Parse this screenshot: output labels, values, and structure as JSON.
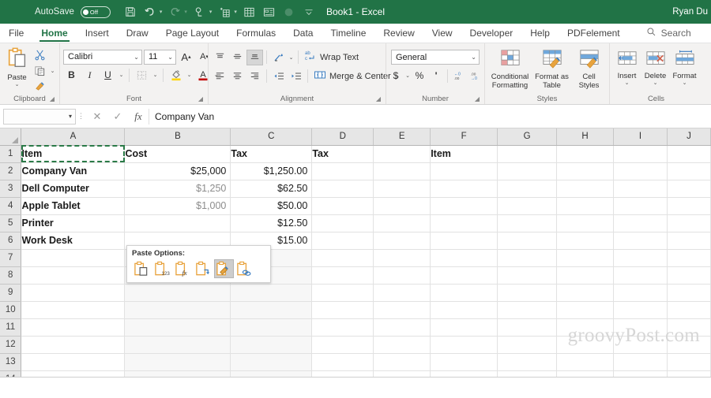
{
  "titlebar": {
    "autosave_label": "AutoSave",
    "autosave_state": "Off",
    "document_title": "Book1  -  Excel",
    "user_name": "Ryan Du",
    "quick_access": [
      {
        "name": "save-icon",
        "label": "Save"
      },
      {
        "name": "undo-icon",
        "label": "Undo"
      },
      {
        "name": "redo-icon",
        "label": "Redo"
      },
      {
        "name": "touch-mode-icon",
        "label": "Touch/Mouse Mode"
      },
      {
        "name": "sort-filter-icon",
        "label": "Sort & Filter"
      },
      {
        "name": "table-icon",
        "label": "Insert Table"
      },
      {
        "name": "form-icon",
        "label": "Form"
      },
      {
        "name": "record-icon",
        "label": "Record Macro"
      },
      {
        "name": "customize-qat-icon",
        "label": "Customize Quick Access Toolbar"
      }
    ]
  },
  "tabs": [
    {
      "label": "File",
      "active": false
    },
    {
      "label": "Home",
      "active": true
    },
    {
      "label": "Insert",
      "active": false
    },
    {
      "label": "Draw",
      "active": false
    },
    {
      "label": "Page Layout",
      "active": false
    },
    {
      "label": "Formulas",
      "active": false
    },
    {
      "label": "Data",
      "active": false
    },
    {
      "label": "Timeline",
      "active": false
    },
    {
      "label": "Review",
      "active": false
    },
    {
      "label": "View",
      "active": false
    },
    {
      "label": "Developer",
      "active": false
    },
    {
      "label": "Help",
      "active": false
    },
    {
      "label": "PDFelement",
      "active": false
    }
  ],
  "search": {
    "label": "Search",
    "placeholder": "Search"
  },
  "ribbon": {
    "clipboard": {
      "group_label": "Clipboard",
      "paste_label": "Paste",
      "cut_label": "Cut",
      "copy_label": "Copy",
      "format_painter_label": "Format Painter"
    },
    "font": {
      "group_label": "Font",
      "font_family": "Calibri",
      "font_size": "11",
      "grow_label": "A",
      "shrink_label": "A",
      "bold_label": "B",
      "italic_label": "I",
      "underline_label": "U"
    },
    "alignment": {
      "group_label": "Alignment",
      "wrap_text_label": "Wrap Text",
      "merge_center_label": "Merge & Center"
    },
    "number": {
      "group_label": "Number",
      "format_value": "General",
      "currency_label": "$",
      "percent_label": "%",
      "comma_label": "'"
    },
    "styles": {
      "group_label": "Styles",
      "conditional_line1": "Conditional",
      "conditional_line2": "Formatting",
      "table_line1": "Format as",
      "table_line2": "Table",
      "cellstyles_line1": "Cell",
      "cellstyles_line2": "Styles"
    },
    "cells": {
      "group_label": "Cells",
      "insert_label": "Insert",
      "delete_label": "Delete",
      "format_label": "Format"
    }
  },
  "formula_bar": {
    "name_box_value": "",
    "cancel_label": "✕",
    "enter_label": "✓",
    "fx_label": "fx",
    "formula_value": "Company Van"
  },
  "grid": {
    "columns": [
      "A",
      "B",
      "C",
      "D",
      "E",
      "F",
      "G",
      "H",
      "I",
      "J"
    ],
    "rows": [
      "1",
      "2",
      "3",
      "4",
      "5",
      "6",
      "7",
      "8",
      "9",
      "10",
      "11",
      "12",
      "13",
      "14"
    ],
    "cells": {
      "A1": "Item",
      "B1": "Cost",
      "C1": "Tax",
      "D1": "Tax",
      "F1": "Item",
      "A2": "Company Van",
      "B2": "$25,000",
      "C2": "$1,250.00",
      "A3": "Dell Computer",
      "B3": "$1,250",
      "C3": "$62.50",
      "A4": "Apple Tablet",
      "B4": "$1,000",
      "C4": "$50.00",
      "A5": "Printer",
      "C5": "$12.50",
      "A6": "Work Desk",
      "C6": "$15.00"
    }
  },
  "paste_options": {
    "title": "Paste Options:",
    "items": [
      {
        "name": "paste-all-icon",
        "label": "Paste",
        "selected": false
      },
      {
        "name": "paste-values-icon",
        "label": "Values",
        "selected": false
      },
      {
        "name": "paste-formulas-icon",
        "label": "Formulas",
        "selected": false
      },
      {
        "name": "paste-transpose-icon",
        "label": "Transpose",
        "selected": false
      },
      {
        "name": "paste-formatting-icon",
        "label": "Formatting",
        "selected": true
      },
      {
        "name": "paste-link-icon",
        "label": "Paste Link",
        "selected": false
      }
    ]
  },
  "watermark": {
    "text": "groovyPost.com"
  },
  "colors": {
    "excel_green": "#217346",
    "ribbon_bg": "#f3f2f1",
    "accent_orange": "#e8a33d",
    "accent_blue": "#3a7cc0"
  }
}
